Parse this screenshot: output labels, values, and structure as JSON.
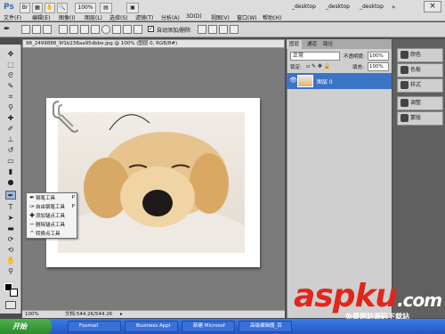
{
  "menubar": {
    "logo": "Ps",
    "items": [
      "文件(F)",
      "编辑(E)",
      "图像(I)",
      "图层(L)",
      "选择(S)",
      "滤镜(T)",
      "分析(A)",
      "3D(D)",
      "视图(V)",
      "窗口(W)",
      "帮助(H)"
    ],
    "zoom": "100%",
    "workspaces": [
      "_desktop",
      "_desktop",
      "_desktop"
    ],
    "close": "×"
  },
  "options": {
    "auto_add_delete": "自动添加/删除"
  },
  "document": {
    "tab_title": "98_2499888_9f1b238aa95dbbe.jpg @ 100% (图层 0, RGB/8#)",
    "zoom": "100%",
    "doc_size": "文档:544.2K/544.2K"
  },
  "pen_menu": {
    "items": [
      "钢笔工具",
      "自由钢笔工具",
      "添加锚点工具",
      "删除锚点工具",
      "转换点工具"
    ],
    "shortcut": "P"
  },
  "layers": {
    "tabs": [
      "图层",
      "通道",
      "路径"
    ],
    "blend_mode": "正常",
    "opacity_label": "不透明度:",
    "opacity_value": "100%",
    "lock_label": "锁定:",
    "fill_label": "填充:",
    "fill_value": "100%",
    "layer_name": "图层 0"
  },
  "dock": {
    "items": [
      "颜色",
      "色板",
      "样式",
      "调整",
      "蒙版"
    ]
  },
  "taskbar": {
    "start": "开始",
    "tasks": [
      "Foxmail",
      "Business Appl",
      "新建 Microsof",
      "高级编辑器_百"
    ]
  },
  "watermark": {
    "main": "aspku",
    "tld": ".com",
    "sub": "免费网站源码下载站"
  }
}
